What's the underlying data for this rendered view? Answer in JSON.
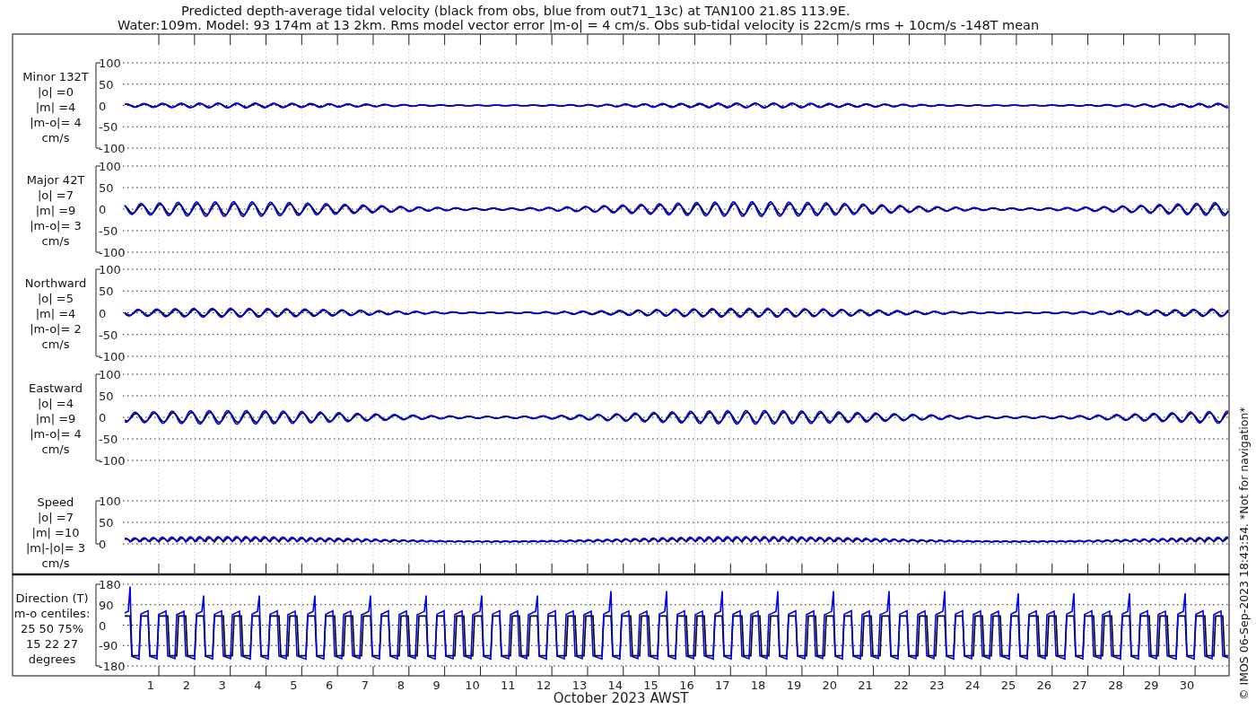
{
  "title": [
    "Predicted depth-average tidal velocity (black from obs, blue from out71_13c) at TAN100 21.8S 113.9E.",
    "Water:109m. Model: 93 174m at 13 2km. Rms model vector error |m-o| = 4 cm/s. Obs sub-tidal velocity is 22cm/s rms + 10cm/s -148T mean"
  ],
  "panels": [
    {
      "kind": "velocity",
      "label_lines": [
        "Minor 132T",
        "|o| =0",
        "|m| =4",
        "|m-o|= 4",
        "cm/s"
      ],
      "yticks": [
        "100",
        "50",
        "0",
        "-50",
        "-100"
      ]
    },
    {
      "kind": "velocity",
      "label_lines": [
        "Major 42T",
        "|o| =7",
        "|m| =9",
        "|m-o|= 3",
        "cm/s"
      ],
      "yticks": [
        "100",
        "50",
        "0",
        "-50",
        "-100"
      ]
    },
    {
      "kind": "velocity",
      "label_lines": [
        "Northward",
        "|o| =5",
        "|m| =4",
        "|m-o|= 2",
        "cm/s"
      ],
      "yticks": [
        "100",
        "50",
        "0",
        "-50",
        "-100"
      ]
    },
    {
      "kind": "velocity",
      "label_lines": [
        "Eastward",
        "|o| =4",
        "|m| =9",
        "|m-o|= 4",
        "cm/s"
      ],
      "yticks": [
        "100",
        "50",
        "0",
        "-50",
        "-100"
      ]
    },
    {
      "kind": "speed",
      "label_lines": [
        "Speed",
        "|o| =7",
        "|m| =10",
        "|m|-|o|= 3",
        "cm/s"
      ],
      "yticks": [
        "100",
        "50",
        "0"
      ]
    },
    {
      "kind": "direction",
      "label_lines": [
        "Direction (T)",
        "m-o centiles:",
        "25  50  75%",
        "15  22  27",
        "degrees"
      ],
      "yticks": [
        "180",
        "90",
        "0",
        "-90",
        "-180"
      ]
    }
  ],
  "x_axis": {
    "day_labels": [
      "1",
      "2",
      "3",
      "4",
      "5",
      "6",
      "7",
      "8",
      "9",
      "10",
      "11",
      "12",
      "13",
      "14",
      "15",
      "16",
      "17",
      "18",
      "19",
      "20",
      "21",
      "22",
      "23",
      "24",
      "25",
      "26",
      "27",
      "28",
      "29",
      "30"
    ],
    "title": "October 2023 AWST"
  },
  "credit": "© IMOS 06-Sep-2023 18:43:54. *Not for navigation*"
}
